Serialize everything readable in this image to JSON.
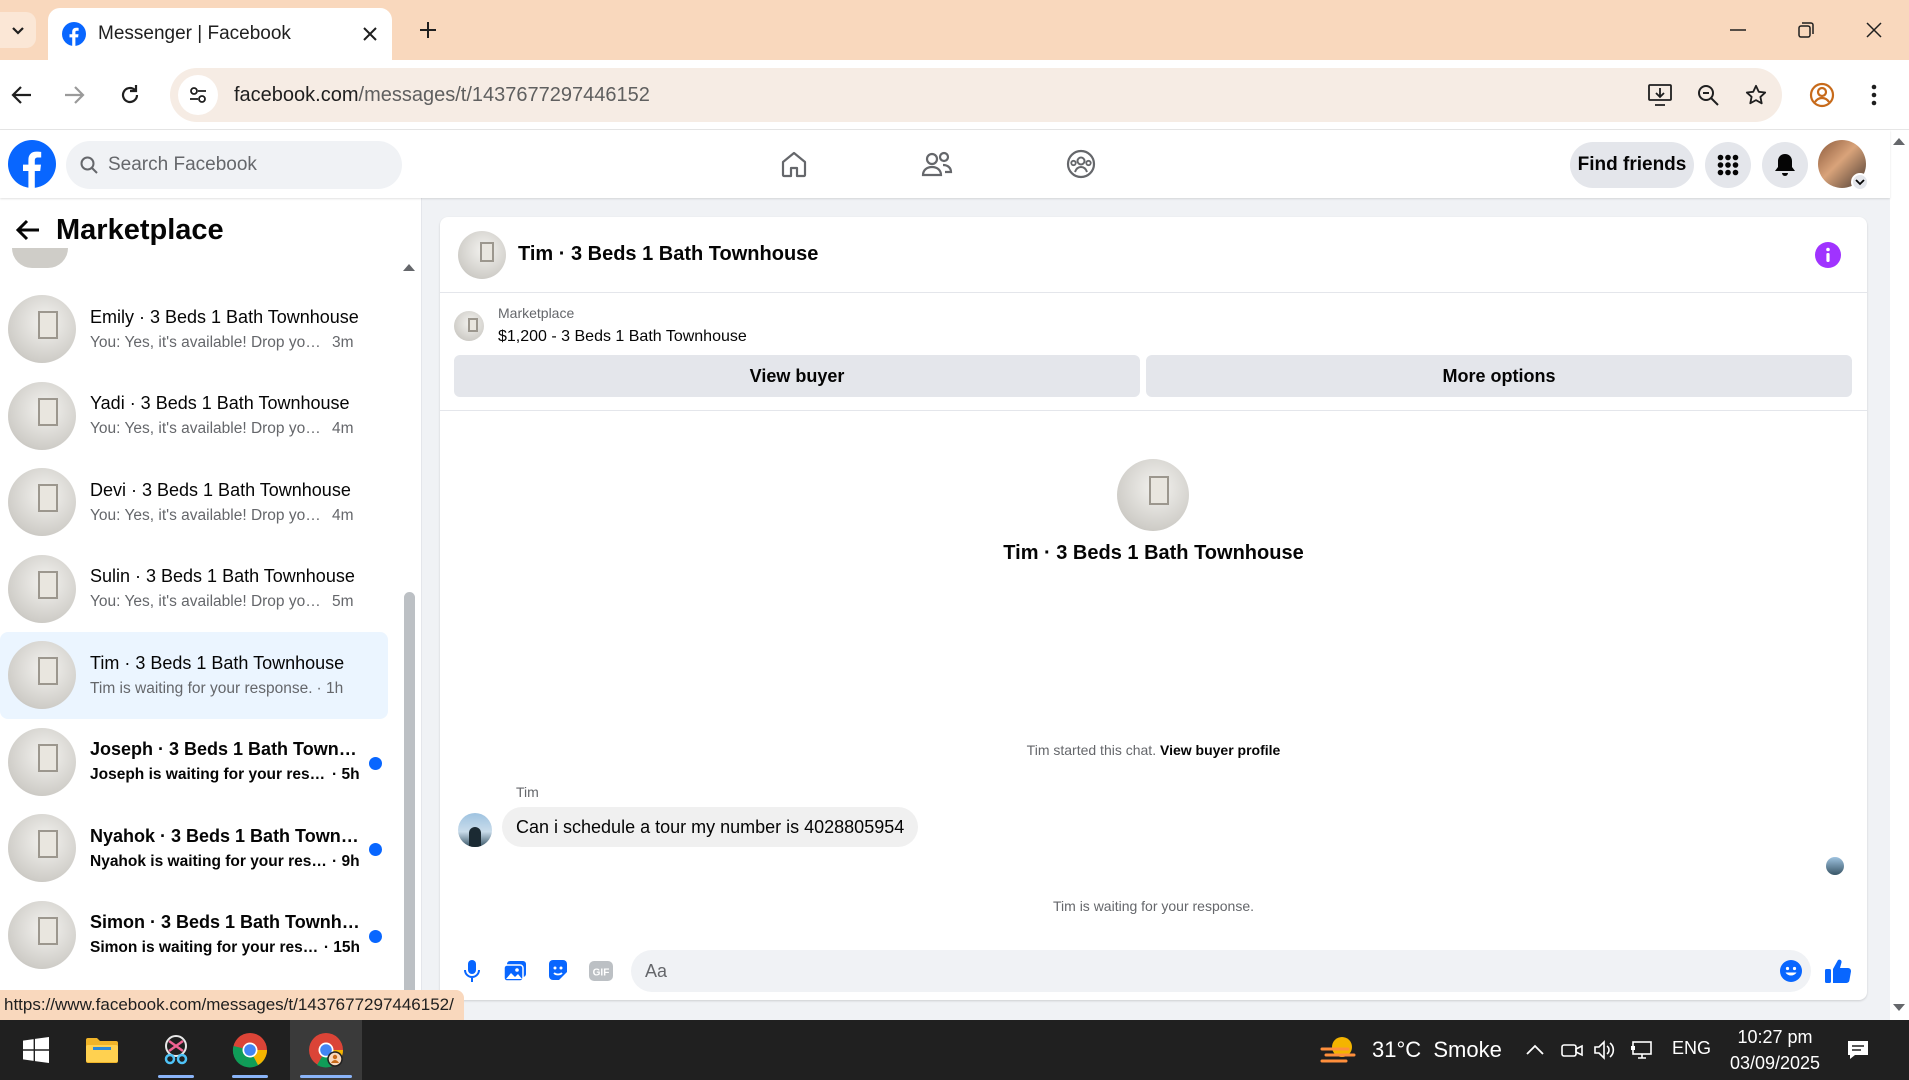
{
  "browser": {
    "tab_title": "Messenger | Facebook",
    "url_host": "facebook.com",
    "url_path": "/messages/t/1437677297446152",
    "status_url": "https://www.facebook.com/messages/t/1437677297446152/"
  },
  "header": {
    "search_placeholder": "Search Facebook",
    "find_friends": "Find friends"
  },
  "sidebar": {
    "title": "Marketplace",
    "conversations": [
      {
        "name": "Emily · 3 Beds 1 Bath Townhouse",
        "preview": "You: Yes, it's available! Drop your ...",
        "time": "3m",
        "unread": false,
        "active": false
      },
      {
        "name": "Yadi · 3 Beds 1 Bath Townhouse",
        "preview": "You: Yes, it's available! Drop your ...",
        "time": "4m",
        "unread": false,
        "active": false
      },
      {
        "name": "Devi · 3 Beds 1 Bath Townhouse",
        "preview": "You: Yes, it's available! Drop your ...",
        "time": "4m",
        "unread": false,
        "active": false
      },
      {
        "name": "Sulin · 3 Beds 1 Bath Townhouse",
        "preview": "You: Yes, it's available! Drop your ...",
        "time": "5m",
        "unread": false,
        "active": false
      },
      {
        "name": "Tim · 3 Beds 1 Bath Townhouse",
        "preview": "Tim is waiting for your response.",
        "time": "· 1h",
        "unread": false,
        "active": true
      },
      {
        "name": "Joseph · 3 Beds 1 Bath Townh...",
        "preview": "Joseph is waiting for your resp...",
        "time": "· 5h",
        "unread": true,
        "active": false
      },
      {
        "name": "Nyahok · 3 Beds 1 Bath Townh...",
        "preview": "Nyahok is waiting for your resp...",
        "time": "· 9h",
        "unread": true,
        "active": false
      },
      {
        "name": "Simon · 3 Beds 1 Bath Townho...",
        "preview": "Simon is waiting for your resp...",
        "time": "· 15h",
        "unread": true,
        "active": false
      }
    ]
  },
  "chat": {
    "title": "Tim · 3 Beds 1 Bath Townhouse",
    "listing_category": "Marketplace",
    "listing_price_title": "$1,200 - 3 Beds 1 Bath Townhouse",
    "view_buyer": "View buyer",
    "more_options": "More options",
    "intro_name": "Tim · 3 Beds 1 Bath Townhouse",
    "started_text": "Tim started this chat.",
    "view_buyer_profile": "View buyer profile",
    "sender_name": "Tim",
    "message": "Can i schedule a tour my number is 4028805954",
    "waiting_text": "Tim is waiting for your response.",
    "input_placeholder": "Aa"
  },
  "taskbar": {
    "weather": "31°C  Smoke",
    "language": "ENG",
    "time": "10:27 pm",
    "date": "03/09/2025"
  },
  "colors": {
    "fb_blue": "#0866ff",
    "tab_bar": "#f9d8bd",
    "info_purple": "#a033ff"
  }
}
